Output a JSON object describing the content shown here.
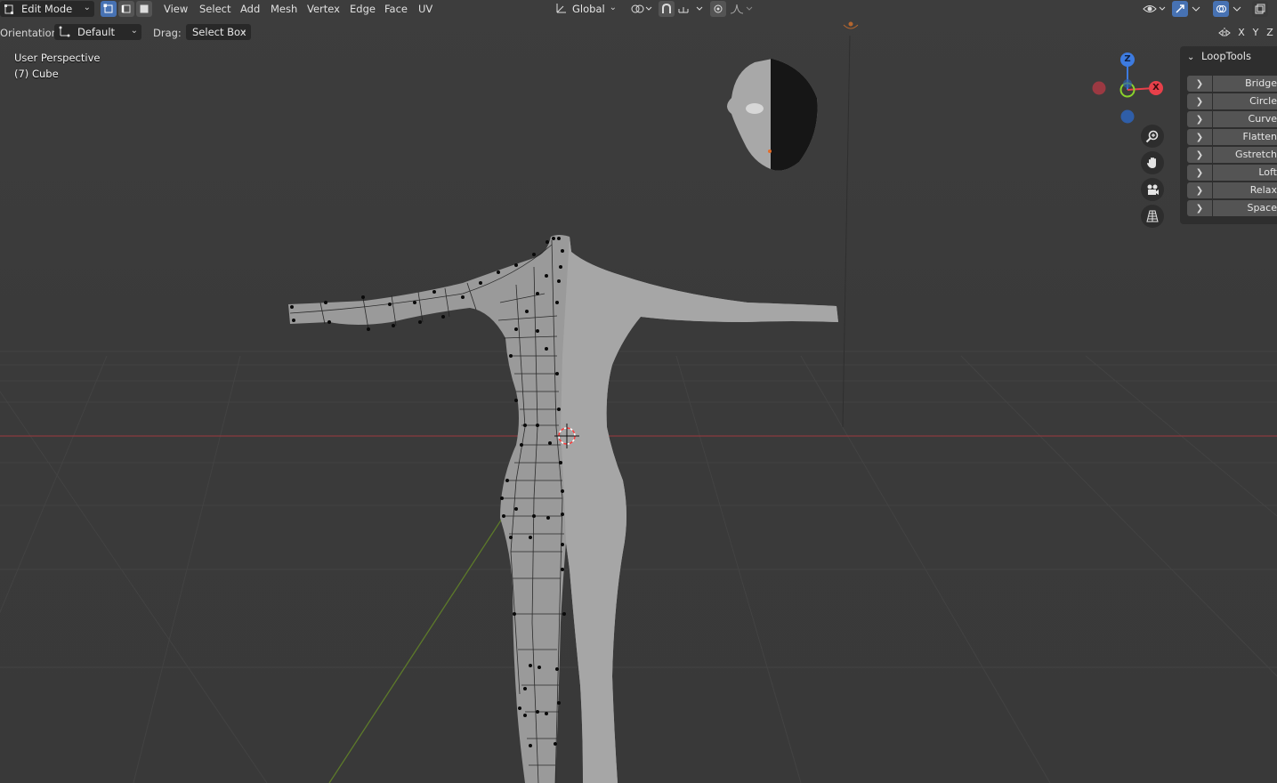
{
  "header": {
    "mode_label": "Edit Mode",
    "menus": [
      "View",
      "Select",
      "Add",
      "Mesh",
      "Vertex",
      "Edge",
      "Face",
      "UV"
    ],
    "transform_space": "Global"
  },
  "tool_settings": {
    "orientation_label": "Orientation:",
    "orientation_value": "Default",
    "drag_label": "Drag:",
    "drag_value": "Select Box"
  },
  "viewport": {
    "view_name": "User Perspective",
    "object_name": "(7) Cube"
  },
  "gizmo": {
    "z": "Z",
    "x": "X"
  },
  "mirror_axes": [
    "X",
    "Y",
    "Z"
  ],
  "side_panel": {
    "title": "LoopTools",
    "items": [
      "Bridge",
      "Circle",
      "Curve",
      "Flatten",
      "Gstretch",
      "Loft",
      "Relax",
      "Space"
    ]
  },
  "colors": {
    "accent": "#4772b3",
    "x_axis": "#e8404a",
    "y_axis": "#8bd32b",
    "z_axis": "#3d7be0"
  }
}
